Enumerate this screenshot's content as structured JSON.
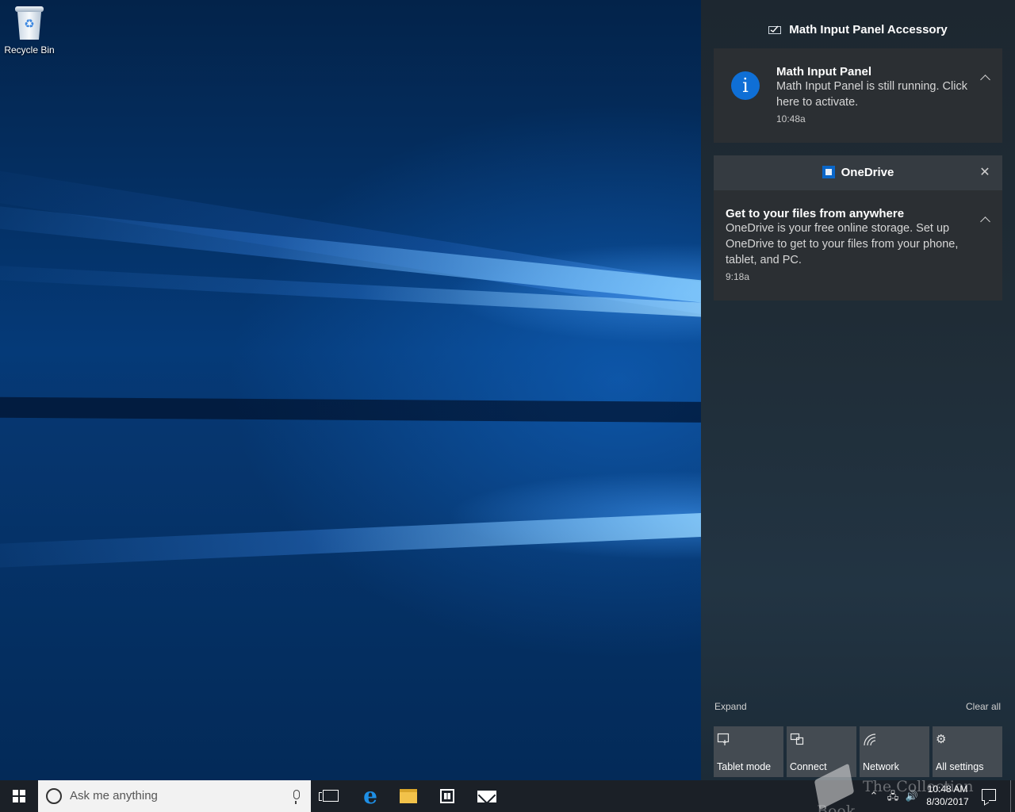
{
  "desktop": {
    "icons": [
      {
        "label": "Recycle Bin"
      }
    ]
  },
  "action_center": {
    "groups": [
      {
        "title": "Math Input Panel Accessory",
        "notifications": [
          {
            "title": "Math Input Panel",
            "body": "Math Input Panel is still running. Click here to activate.",
            "time": "10:48a",
            "icon": "info-icon"
          }
        ]
      },
      {
        "title": "OneDrive",
        "notifications": [
          {
            "title": "Get to your files from anywhere",
            "body": "OneDrive is your free online storage. Set up OneDrive to get to your files from your phone, tablet, and PC.",
            "time": "9:18a"
          }
        ]
      }
    ],
    "expand_label": "Expand",
    "clear_all_label": "Clear all",
    "quick_actions": [
      {
        "label": "Tablet mode",
        "icon": "tablet-mode-icon"
      },
      {
        "label": "Connect",
        "icon": "connect-icon"
      },
      {
        "label": "Network",
        "icon": "network-icon"
      },
      {
        "label": "All settings",
        "icon": "gear-icon"
      }
    ]
  },
  "taskbar": {
    "search_placeholder": "Ask me anything",
    "clock_time": "10:48 AM",
    "clock_date": "8/30/2017"
  },
  "watermark": {
    "text": "The Collection Book"
  },
  "colors": {
    "accent": "#0f6fd6",
    "card": "#2b2f33",
    "taskbar": "#1b2027"
  }
}
